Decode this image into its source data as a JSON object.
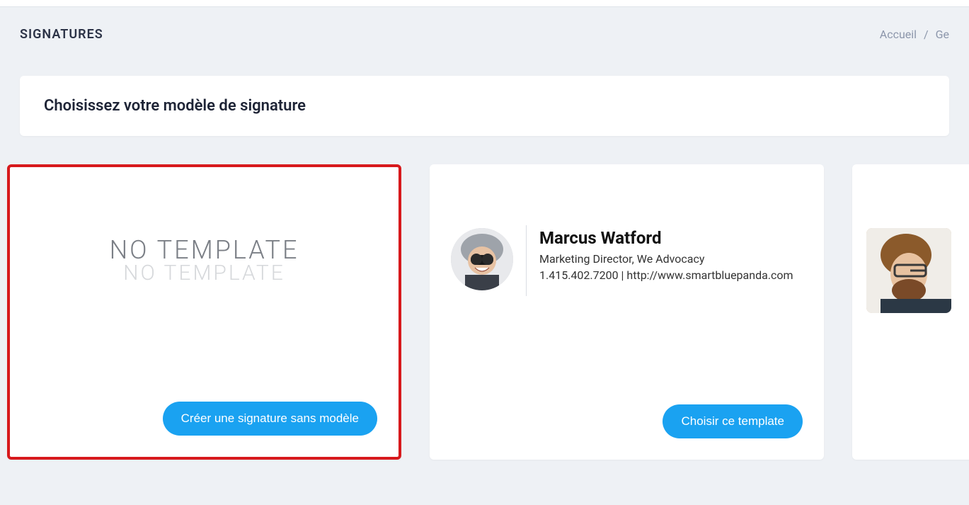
{
  "header": {
    "title": "SIGNATURES"
  },
  "breadcrumb": {
    "home": "Accueil",
    "separator": "/",
    "current_partial": "Ge"
  },
  "panel": {
    "title": "Choisissez votre modèle de signature"
  },
  "cards": [
    {
      "no_template_top": "NO TEMPLATE",
      "no_template_reflection": "NO TEMPLATE",
      "button_label": "Créer une signature sans modèle"
    },
    {
      "signature": {
        "name": "Marcus Watford",
        "title_line": "Marketing Director, We Advocacy",
        "contact_line": "1.415.402.7200 | http://www.smartbluepanda.com"
      },
      "button_label": "Choisir ce template"
    },
    {
      "signature": {
        "name": ""
      }
    }
  ],
  "colors": {
    "accent": "#1aa2f1",
    "highlight_border": "#d7191c",
    "bg": "#eef1f5"
  }
}
